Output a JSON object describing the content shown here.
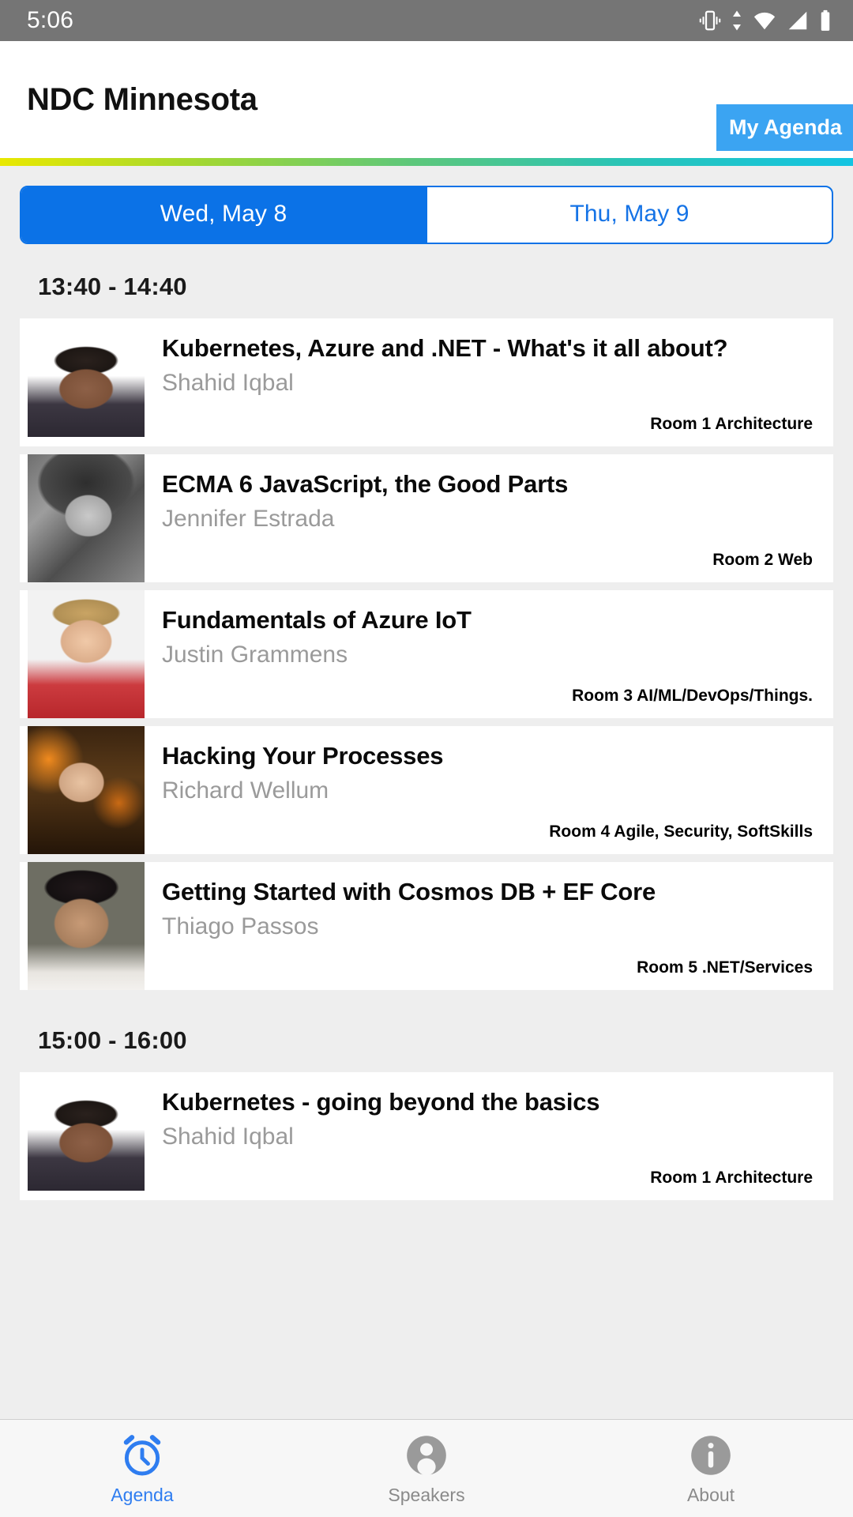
{
  "status_bar": {
    "time": "5:06",
    "icons": [
      "vibrate-icon",
      "data-transfer-icon",
      "wifi-icon",
      "signal-icon",
      "battery-icon"
    ]
  },
  "header": {
    "title": "NDC Minnesota",
    "my_agenda_label": "My Agenda",
    "accent_color": "#3ba4f2"
  },
  "gradient_bar": {
    "from": "#e9e800",
    "mid": "#5ec77a",
    "to": "#13c4e2"
  },
  "day_tabs": {
    "selected_index": 0,
    "items": [
      {
        "label": "Wed, May 8",
        "active": true
      },
      {
        "label": "Thu, May 9",
        "active": false
      }
    ],
    "active_bg": "#0b72e7",
    "inactive_text": "#1573e6"
  },
  "agenda": {
    "groups": [
      {
        "time": "13:40 - 14:40",
        "sessions": [
          {
            "title": "Kubernetes, Azure and .NET - What's it all about?",
            "speaker": "Shahid Iqbal",
            "room": "Room 1 Architecture",
            "photo": "photo-shahid",
            "photo_inset": true
          },
          {
            "title": "ECMA 6 JavaScript, the Good Parts",
            "speaker": "Jennifer Estrada",
            "room": "Room 2 Web",
            "photo": "photo-jennifer",
            "photo_inset": false
          },
          {
            "title": "Fundamentals of Azure IoT",
            "speaker": "Justin Grammens",
            "room": "Room 3 AI/ML/DevOps/Things.",
            "photo": "photo-justin",
            "photo_inset": false
          },
          {
            "title": "Hacking Your Processes",
            "speaker": "Richard Wellum",
            "room": "Room 4 Agile, Security, SoftSkills",
            "photo": "photo-richard",
            "photo_inset": false
          },
          {
            "title": "Getting Started with Cosmos DB + EF Core",
            "speaker": "Thiago Passos",
            "room": "Room 5 .NET/Services",
            "photo": "photo-thiago",
            "photo_inset": false
          }
        ]
      },
      {
        "time": "15:00 - 16:00",
        "sessions": [
          {
            "title": "Kubernetes - going beyond the basics",
            "speaker": "Shahid Iqbal",
            "room": "Room 1 Architecture",
            "photo": "photo-shahid",
            "photo_inset": true
          }
        ]
      }
    ]
  },
  "bottom_nav": {
    "items": [
      {
        "label": "Agenda",
        "icon": "alarm-clock-icon",
        "active": true
      },
      {
        "label": "Speakers",
        "icon": "person-circle-icon",
        "active": false
      },
      {
        "label": "About",
        "icon": "info-circle-icon",
        "active": false
      }
    ],
    "active_color": "#2f7df0",
    "inactive_color": "#8a8a8a"
  }
}
